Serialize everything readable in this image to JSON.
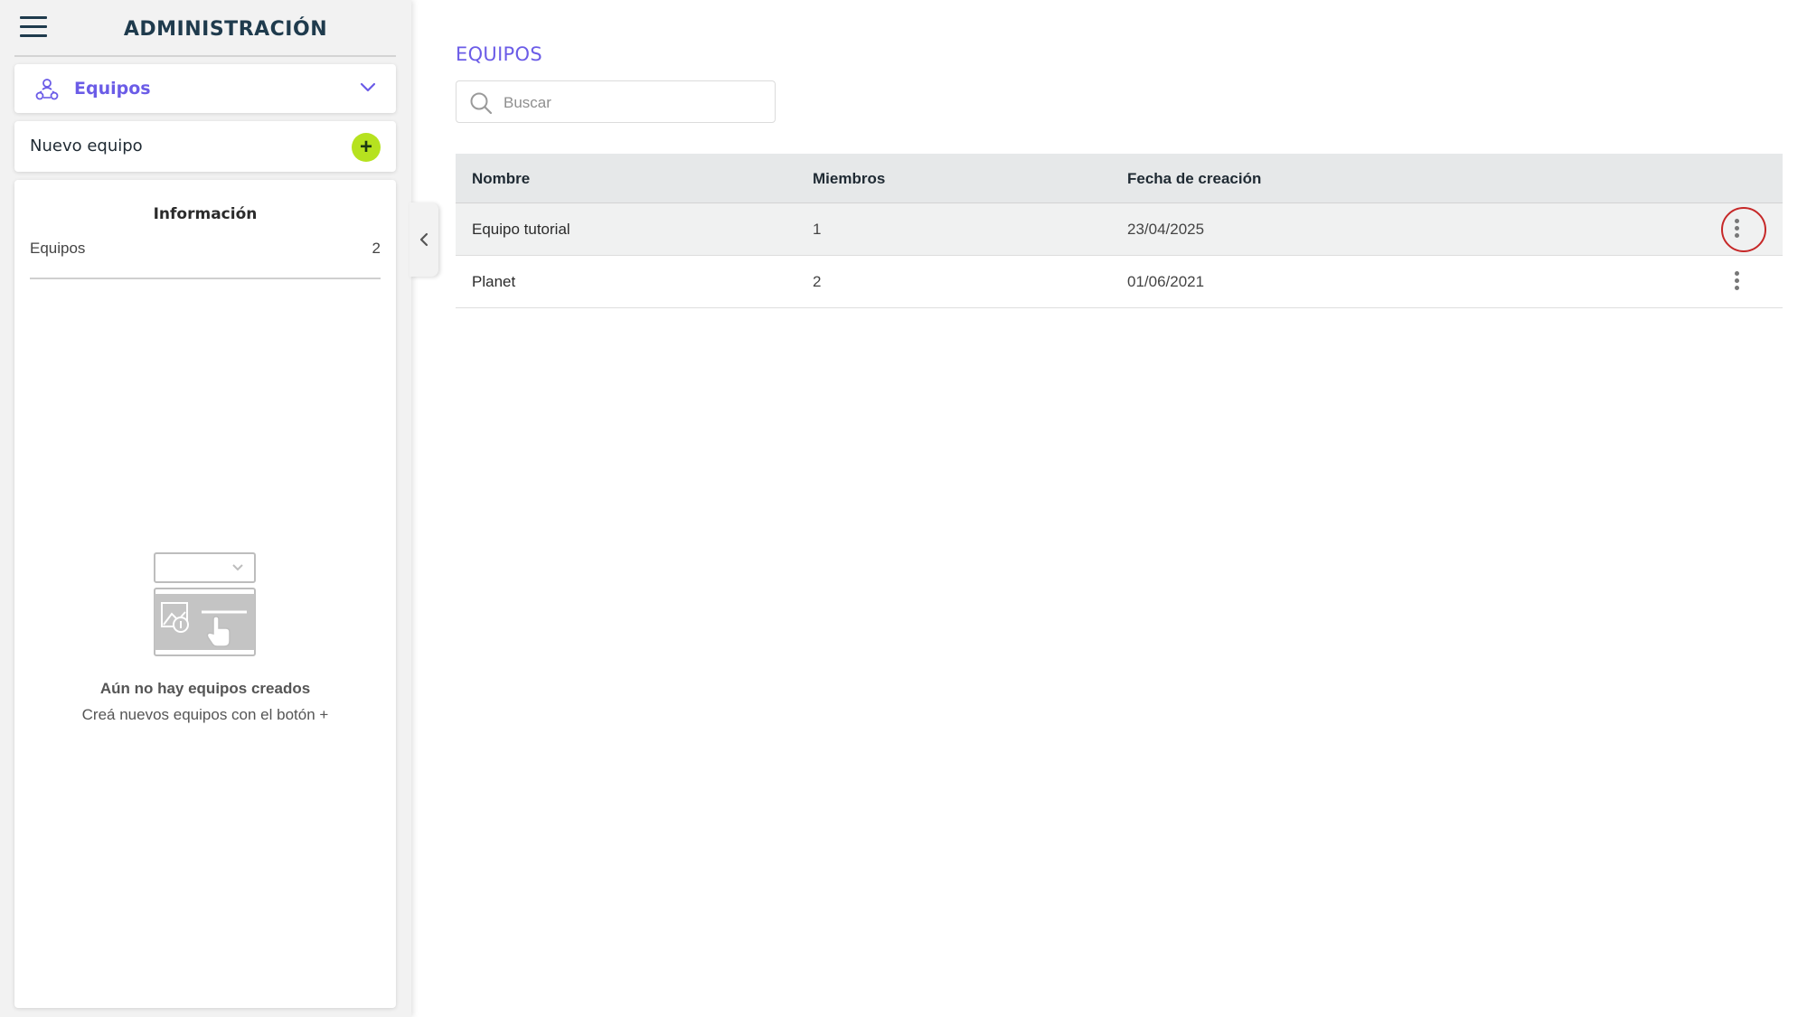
{
  "sidebar": {
    "title": "ADMINISTRACIÓN",
    "section": {
      "label": "Equipos",
      "icon": "teams-icon"
    },
    "new_item": {
      "label": "Nuevo equipo",
      "add_symbol": "+"
    },
    "info": {
      "title": "Información",
      "rows": [
        {
          "label": "Equipos",
          "value": "2"
        }
      ]
    },
    "empty_state": {
      "title": "Aún no hay equipos creados",
      "subtitle": "Creá nuevos equipos con el botón +"
    }
  },
  "main": {
    "title": "EQUIPOS",
    "search": {
      "placeholder": "Buscar",
      "value": ""
    },
    "table": {
      "headers": [
        "Nombre",
        "Miembros",
        "Fecha de creación"
      ],
      "rows": [
        {
          "name": "Equipo tutorial",
          "members": "1",
          "created": "23/04/2025",
          "highlighted": true
        },
        {
          "name": "Planet",
          "members": "2",
          "created": "01/06/2021",
          "highlighted": false
        }
      ]
    }
  },
  "colors": {
    "accent": "#6b5ce7",
    "add_button": "#b6e21f",
    "highlight_ring": "#c62828",
    "header_text": "#1f3b4d"
  }
}
